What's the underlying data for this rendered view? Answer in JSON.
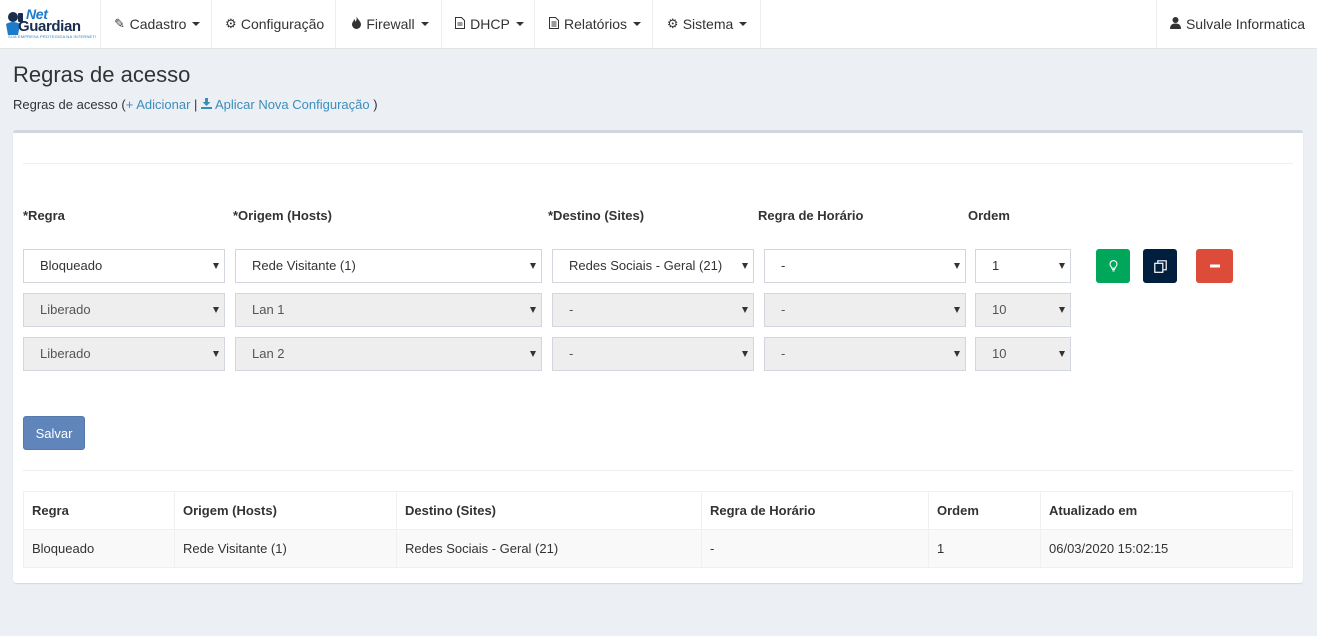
{
  "brand": {
    "name_top": "Net",
    "name_bottom": "Guardian",
    "tagline": "SUA EMPRESA PROTEGIDA NA INTERNET!",
    "colors": {
      "blue": "#1e7bc8",
      "navy": "#1b2d4f"
    }
  },
  "nav": {
    "items": [
      {
        "label": "Cadastro",
        "icon": "edit-icon",
        "dropdown": true
      },
      {
        "label": "Configuração",
        "icon": "gear-icon",
        "dropdown": false
      },
      {
        "label": "Firewall",
        "icon": "fire-icon",
        "dropdown": true
      },
      {
        "label": "DHCP",
        "icon": "file-icon",
        "dropdown": true
      },
      {
        "label": "Relatórios",
        "icon": "document-icon",
        "dropdown": true
      },
      {
        "label": "Sistema",
        "icon": "gears-icon",
        "dropdown": true
      }
    ],
    "user": {
      "label": "Sulvale Informatica",
      "icon": "user-icon"
    }
  },
  "page": {
    "title": "Regras de acesso",
    "breadcrumb": {
      "text": "Regras de acesso (",
      "add_link": "+ Adicionar",
      "separator": "|",
      "apply_link": "Aplicar Nova Configuração",
      "close": ")"
    }
  },
  "form": {
    "columns": {
      "regra": "*Regra",
      "origem": "*Origem (Hosts)",
      "destino": "*Destino (Sites)",
      "horario": "Regra de Horário",
      "ordem": "Ordem"
    },
    "rows": [
      {
        "regra": "Bloqueado",
        "origem": "Rede Visitante (1)",
        "destino": "Redes Sociais - Geral (21)",
        "horario": "-",
        "ordem": "1",
        "editable": true
      },
      {
        "regra": "Liberado",
        "origem": "Lan 1",
        "destino": "-",
        "horario": "-",
        "ordem": "10",
        "editable": false
      },
      {
        "regra": "Liberado",
        "origem": "Lan 2",
        "destino": "-",
        "horario": "-",
        "ordem": "10",
        "editable": false
      }
    ],
    "actions": {
      "activate": {
        "icon": "lightbulb-icon",
        "color": "#00a65a"
      },
      "copy": {
        "icon": "copy-icon",
        "color": "#001f3f"
      },
      "remove": {
        "icon": "minus-icon",
        "color": "#dd4b39"
      }
    },
    "save_label": "Salvar"
  },
  "table": {
    "headers": [
      "Regra",
      "Origem (Hosts)",
      "Destino (Sites)",
      "Regra de Horário",
      "Ordem",
      "Atualizado em"
    ],
    "rows": [
      [
        "Bloqueado",
        "Rede Visitante (1)",
        "Redes Sociais - Geral (21)",
        "-",
        "1",
        "06/03/2020 15:02:15"
      ]
    ]
  }
}
